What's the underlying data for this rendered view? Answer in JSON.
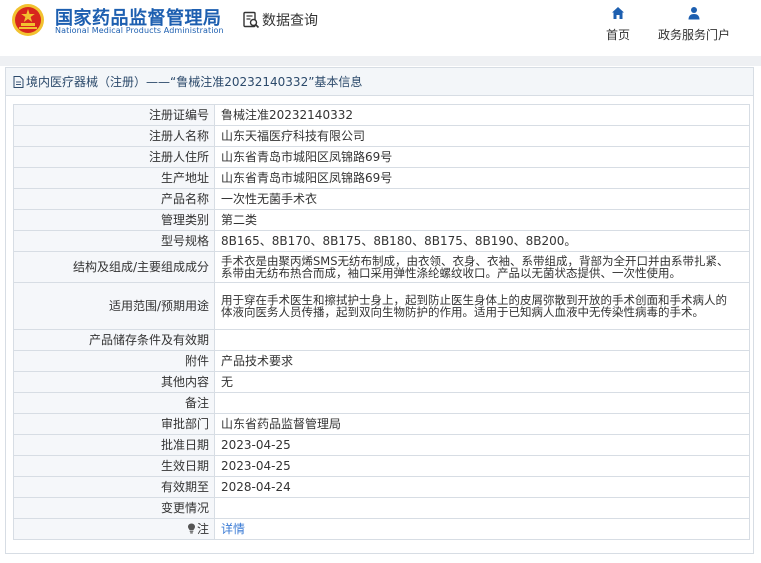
{
  "header": {
    "brand_cn": "国家药品监督管理局",
    "brand_en": "National Medical Products Administration",
    "query_label": "数据查询",
    "nav": [
      {
        "label": "首页",
        "icon": "home-icon"
      },
      {
        "label": "政务服务门户",
        "icon": "user-icon"
      }
    ]
  },
  "panel": {
    "title": "境内医疗器械（注册）——“鲁械注准20232140332”基本信息"
  },
  "rows": [
    {
      "label": "注册证编号",
      "value": "鲁械注准20232140332"
    },
    {
      "label": "注册人名称",
      "value": "山东天福医疗科技有限公司"
    },
    {
      "label": "注册人住所",
      "value": "山东省青岛市城阳区凤锦路69号"
    },
    {
      "label": "生产地址",
      "value": "山东省青岛市城阳区凤锦路69号"
    },
    {
      "label": "产品名称",
      "value": "一次性无菌手术衣"
    },
    {
      "label": "管理类别",
      "value": "第二类"
    },
    {
      "label": "型号规格",
      "value": "8B165、8B170、8B175、8B180、8B175、8B190、8B200。"
    },
    {
      "label": "结构及组成/主要组成成分",
      "value": "手术衣是由聚丙烯SMS无纺布制成，由衣领、衣身、衣袖、系带组成，背部为全开口并由系带扎紧、系带由无纺布热合而成，袖口采用弹性涤纶螺纹收口。产品以无菌状态提供、一次性使用。"
    },
    {
      "label": "适用范围/预期用途",
      "value": "用于穿在手术医生和擦拭护士身上，起到防止医生身体上的皮屑弥散到开放的手术创面和手术病人的体液向医务人员传播，起到双向生物防护的作用。适用于已知病人血液中无传染性病毒的手术。"
    },
    {
      "label": "产品储存条件及有效期",
      "value": ""
    },
    {
      "label": "附件",
      "value": "产品技术要求"
    },
    {
      "label": "其他内容",
      "value": "无"
    },
    {
      "label": "备注",
      "value": ""
    },
    {
      "label": "审批部门",
      "value": "山东省药品监督管理局"
    },
    {
      "label": "批准日期",
      "value": "2023-04-25"
    },
    {
      "label": "生效日期",
      "value": "2023-04-25"
    },
    {
      "label": "有效期至",
      "value": "2028-04-24"
    },
    {
      "label": "变更情况",
      "value": ""
    },
    {
      "label": "注",
      "value": "详情",
      "icon": "lightbulb-icon"
    }
  ],
  "colors": {
    "brand_blue": "#1d5fb0",
    "label_bg": "#f5f7fa",
    "border": "#d7dde4",
    "link": "#3a7bd5",
    "emblem_red": "#d7261d",
    "emblem_gold": "#f2c230"
  }
}
